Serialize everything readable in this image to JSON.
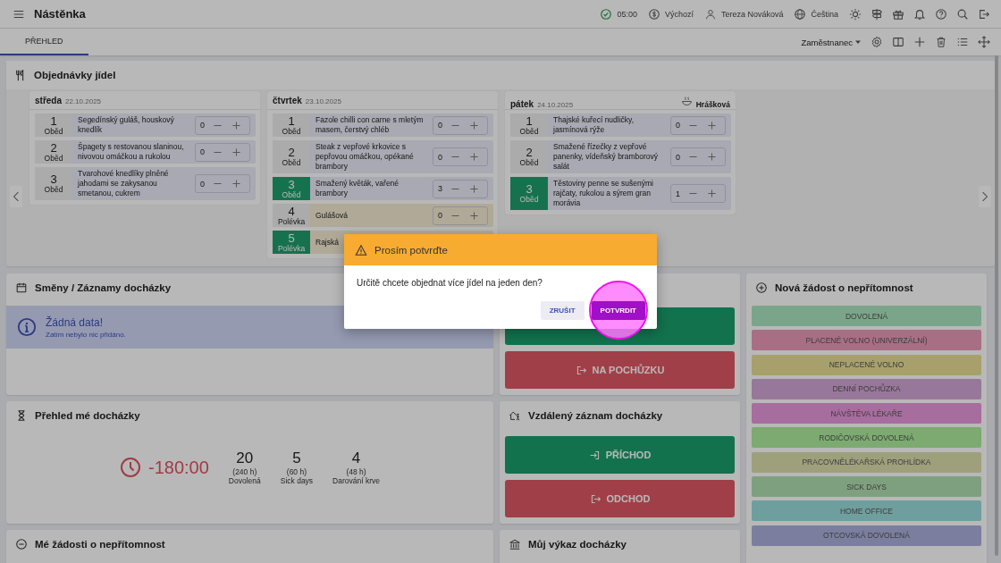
{
  "topbar": {
    "title": "Nástěnka",
    "status": [
      {
        "label": "05:00"
      },
      {
        "label": "Výchozí"
      },
      {
        "label": "Tereza Nováková"
      },
      {
        "label": "Čeština"
      }
    ]
  },
  "tabs": [
    {
      "label": "PŘEHLED",
      "selected": true
    }
  ],
  "role_select": {
    "value": "Zaměstnanec"
  },
  "meals": {
    "title": "Objednávky jídel",
    "days": [
      {
        "name": "středa",
        "date": "22.10.2025",
        "items": [
          {
            "kind": "main",
            "number": "1",
            "type": "Oběd",
            "name": "Segedínský guláš, houskový knedlík",
            "qty": "0",
            "ordered": false
          },
          {
            "kind": "main",
            "number": "2",
            "type": "Oběd",
            "name": "Špagety s restovanou slaninou, nivovou omáčkou a rukolou",
            "qty": "0",
            "ordered": false
          },
          {
            "kind": "main",
            "number": "3",
            "type": "Oběd",
            "name": "Tvarohové knedlíky plněné jahodami se zakysanou smetanou, cukrem",
            "qty": "0",
            "ordered": false
          }
        ]
      },
      {
        "name": "čtvrtek",
        "date": "23.10.2025",
        "items": [
          {
            "kind": "main",
            "number": "1",
            "type": "Oběd",
            "name": "Fazole chilli con carne s mletým masem, čerstvý chléb",
            "qty": "0",
            "ordered": false
          },
          {
            "kind": "main",
            "number": "2",
            "type": "Oběd",
            "name": "Steak z vepřové krkovice s pepřovou omáčkou, opékané brambory",
            "qty": "0",
            "ordered": false
          },
          {
            "kind": "main",
            "number": "3",
            "type": "Oběd",
            "name": "Smažený květák, vařené brambory",
            "qty": "3",
            "ordered": true
          },
          {
            "kind": "soup",
            "number": "4",
            "type": "Polévka",
            "name": "Gulášová",
            "qty": "0",
            "ordered": false
          },
          {
            "kind": "soup",
            "number": "5",
            "type": "Polévka",
            "name": "Rajská",
            "ordered": true
          }
        ]
      },
      {
        "name": "pátek",
        "date": "24.10.2025",
        "soup": "Hrášková",
        "items": [
          {
            "kind": "main",
            "number": "1",
            "type": "Oběd",
            "name": "Thajské kuřecí nudličky, jasmínová rýže",
            "qty": "0",
            "ordered": false
          },
          {
            "kind": "main",
            "number": "2",
            "type": "Oběd",
            "name": "Smažené řízečky z vepřové panenky, vídeňský bramborový salát",
            "qty": "0",
            "ordered": false
          },
          {
            "kind": "main",
            "number": "3",
            "type": "Oběd",
            "name": "Těstoviny penne se sušenými rajčaty, rukolou a sýrem gran morávia",
            "qty": "1",
            "ordered": true
          }
        ]
      }
    ]
  },
  "shifts": {
    "title": "Směny / Záznamy docházky",
    "alert": {
      "title": "Žádná data!",
      "text": "Zatím nebylo nic přidáno."
    }
  },
  "errand": {
    "buttons": [
      {
        "kind": "in"
      },
      {
        "kind": "out",
        "label": "NA POCHŮZKU"
      }
    ]
  },
  "absence": {
    "title": "Nová žádost o nepřítomnost",
    "types": [
      {
        "label": "DOVOLENÁ",
        "color": "#7ba58a"
      },
      {
        "label": "PLACENÉ VOLNO (UNIVERZÁLNÍ)",
        "color": "#a86f84"
      },
      {
        "label": "NEPLACENÉ VOLNO",
        "color": "#a7a06c"
      },
      {
        "label": "DENNÍ POCHŮZKA",
        "color": "#98789a"
      },
      {
        "label": "NÁVŠTĚVA LÉKAŘE",
        "color": "#a66d9e"
      },
      {
        "label": "RODIČOVSKÁ DOVOLENÁ",
        "color": "#7caa70"
      },
      {
        "label": "PRACOVNĚLÉKAŘSKÁ PROHLÍDKA",
        "color": "#9ea07c"
      },
      {
        "label": "SICK DAYS",
        "color": "#7fa07f"
      },
      {
        "label": "HOME OFFICE",
        "color": "#6f9e9e"
      },
      {
        "label": "OTCOVSKÁ DOVOLENÁ",
        "color": "#7b7e9e"
      }
    ]
  },
  "overview": {
    "title": "Přehled mé docházky",
    "balance": "-180:00",
    "stats": [
      {
        "value": "20",
        "hours": "(240 h)",
        "label": "Dovolená"
      },
      {
        "value": "5",
        "hours": "(60 h)",
        "label": "Sick days"
      },
      {
        "value": "4",
        "hours": "(48 h)",
        "label": "Darování krve"
      }
    ]
  },
  "remote": {
    "title": "Vzdálený záznam docházky",
    "buttons": [
      {
        "kind": "in",
        "label": "PŘÍCHOD"
      },
      {
        "kind": "out",
        "label": "ODCHOD"
      }
    ]
  },
  "requests": {
    "title": "Mé žádosti o nepřítomnost"
  },
  "report": {
    "title": "Můj výkaz docházky"
  },
  "dialog": {
    "title": "Prosím potvrďte",
    "message": "Určitě chcete objednat více jídel na jeden den?",
    "buttons": [
      {
        "kind": "secondary",
        "label": "ZRUŠIT",
        "pressed": false
      },
      {
        "kind": "primary",
        "label": "POTVRDIT",
        "pressed": true
      }
    ]
  }
}
